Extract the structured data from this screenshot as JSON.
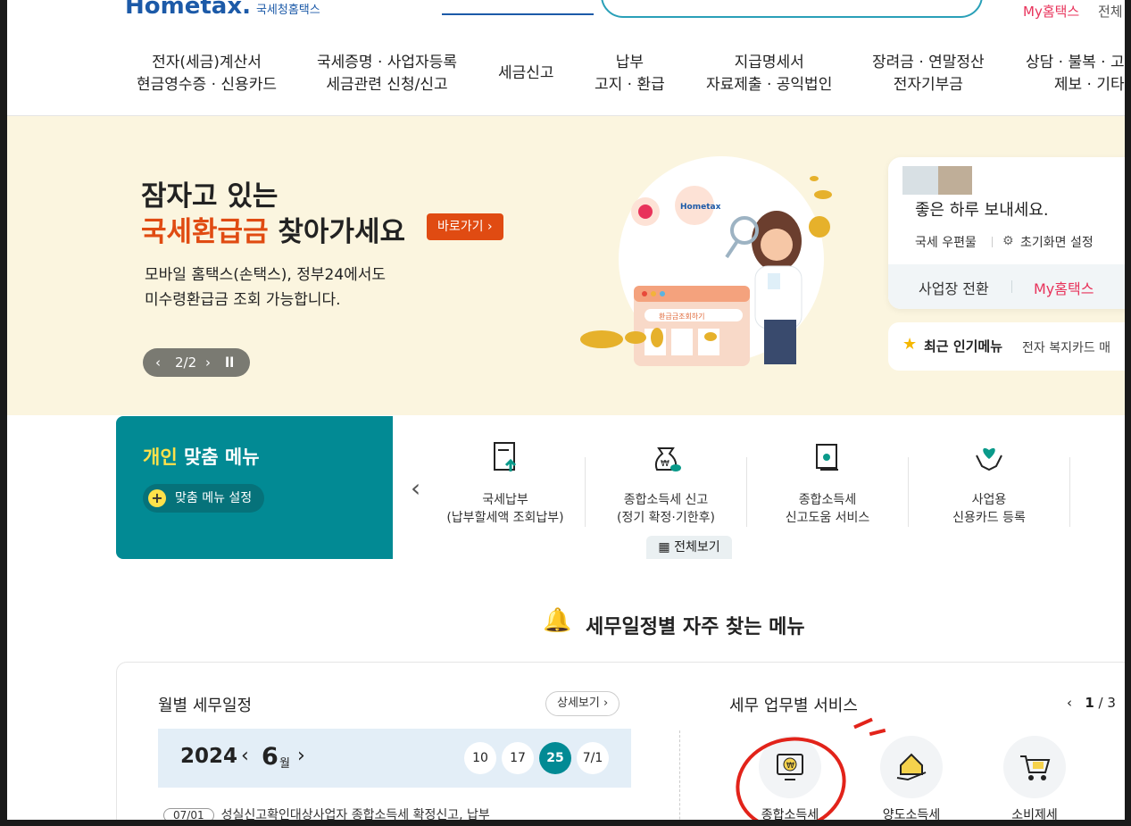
{
  "header": {
    "logo_text": "Hometax.",
    "logo_sub": "국세청홈택스",
    "my_hometax": "My홈택스",
    "all_menu": "전체"
  },
  "gnb": [
    {
      "line1": "전자(세금)계산서",
      "line2": "현금영수증 · 신용카드"
    },
    {
      "line1": "국세증명 · 사업자등록",
      "line2": "세금관련 신청/신고"
    },
    {
      "line1": "세금신고",
      "line2": ""
    },
    {
      "line1": "납부",
      "line2": "고지 · 환급"
    },
    {
      "line1": "지급명세서",
      "line2": "자료제출 · 공익법인"
    },
    {
      "line1": "장려금 · 연말정산",
      "line2": "전자기부금"
    },
    {
      "line1": "상담 · 불복 · 고",
      "line2": "제보 · 기타"
    }
  ],
  "banner": {
    "title_line1": "잠자고 있는",
    "title_line2_highlight": "국세환급금",
    "title_line2_rest": " 찾아가세요",
    "go_button": "바로가기",
    "desc_line1": "모바일 홈택스(손택스), 정부24에서도",
    "desc_line2": "미수령환급금 조회 가능합니다.",
    "pager_text": "2/2",
    "illustration_label": "환급금조회하기"
  },
  "user_card": {
    "greeting": "좋은 하루 보내세요.",
    "mailbox": "국세 우편물",
    "reset_home": "초기화면 설정",
    "switch_business": "사업장 전환",
    "my_hometax": "My홈택스"
  },
  "popular": {
    "label": "최근 인기메뉴",
    "items": "전자 복지카드 매"
  },
  "custom_menu": {
    "title_highlight": "개인",
    "title_rest": " 맞춤 메뉴",
    "setting": "맞춤 메뉴 설정",
    "view_all": "전체보기",
    "items": [
      {
        "line1": "국세납부",
        "line2": "(납부할세액 조회납부)",
        "icon": "document-upload-icon"
      },
      {
        "line1": "종합소득세 신고",
        "line2": "(정기 확정·기한후)",
        "icon": "money-bag-icon"
      },
      {
        "line1": "종합소득세",
        "line2": "신고도움 서비스",
        "icon": "monitor-person-icon"
      },
      {
        "line1": "사업용",
        "line2": "신용카드 등록",
        "icon": "heart-hands-icon"
      }
    ]
  },
  "schedule": {
    "heading": "세무일정별 자주 찾는 메뉴",
    "monthly_title": "월별 세무일정",
    "detail_button": "상세보기",
    "year": "2024",
    "month": "6",
    "month_unit": "월",
    "days": [
      "10",
      "17",
      "25",
      "7/1"
    ],
    "active_day": "25",
    "row_date": "07/01",
    "row_text": "성실신고확인대상사업자 종합소득세 확정신고, 납부"
  },
  "services": {
    "title": "세무 업무별 서비스",
    "page_current": "1",
    "page_total": "/ 3",
    "items": [
      {
        "label": "종합소득세",
        "icon": "tax-monitor-icon"
      },
      {
        "label": "양도소득세",
        "icon": "house-hand-icon"
      },
      {
        "label": "소비제세",
        "icon": "cart-icon"
      }
    ]
  },
  "colors": {
    "brand_teal": "#028a94",
    "accent_orange": "#e04b12",
    "accent_pink": "#e8335b",
    "banner_bg": "#fbf5df",
    "annotation_red": "#e2231a"
  }
}
